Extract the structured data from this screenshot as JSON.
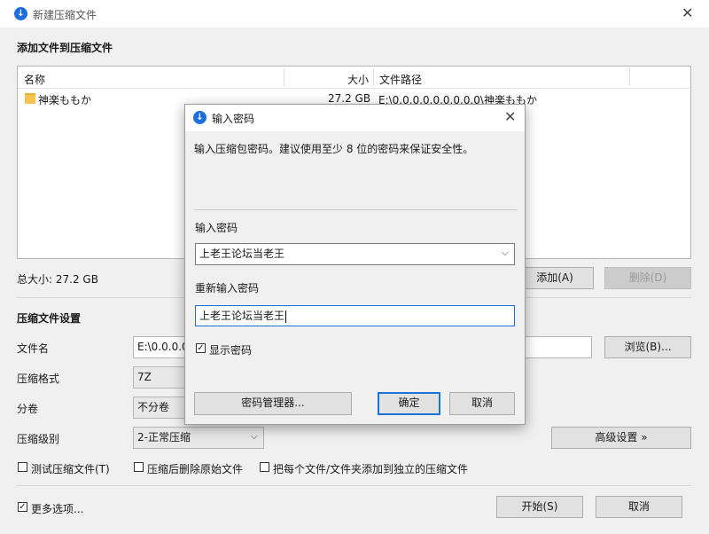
{
  "window": {
    "title": "新建压缩文件",
    "close_glyph": "✕"
  },
  "section_files": {
    "title": "添加文件到压缩文件"
  },
  "file_list": {
    "columns": [
      "名称",
      "大小",
      "文件路径"
    ],
    "rows": [
      {
        "name": "神楽ももか",
        "size": "27.2 GB",
        "path": "E:\\0.0.0.0.0.0.0.0.0\\神楽ももか"
      }
    ]
  },
  "total_size": "总大小: 27.2 GB",
  "buttons": {
    "add": "添加(A)",
    "delete": "删除(D)",
    "browse": "浏览(B)...",
    "advanced": "高级设置 »",
    "start": "开始(S)",
    "cancel": "取消"
  },
  "settings": {
    "title": "压缩文件设置",
    "filename_label": "文件名",
    "filename_value": "E:\\0.0.0.0",
    "format_label": "压缩格式",
    "format_value": "7Z",
    "split_label": "分卷",
    "split_value": "不分卷",
    "level_label": "压缩级别",
    "level_value": "2-正常压缩"
  },
  "options": {
    "test": "测试压缩文件(T)",
    "delete_original": "压缩后删除原始文件",
    "separate": "把每个文件/文件夹添加到独立的压缩文件",
    "more": "更多选项..."
  },
  "dialog": {
    "title": "输入密码",
    "description": "输入压缩包密码。建议使用至少 8 位的密码来保证安全性。",
    "pwd_label": "输入密码",
    "pwd_value": "上老王论坛当老王",
    "repeat_label": "重新输入密码",
    "repeat_value": "上老王论坛当老王",
    "show_pwd": "显示密码",
    "manager": "密码管理器...",
    "ok": "确定",
    "cancel": "取消"
  },
  "colors": {
    "accent": "#1e6fd9",
    "background": "#f0f0f0"
  },
  "icons": {
    "app": "app-logo-icon",
    "folder": "folder-icon",
    "close": "close-icon",
    "chevron": "chevron-down-icon",
    "check": "checkbox-checked-icon"
  }
}
